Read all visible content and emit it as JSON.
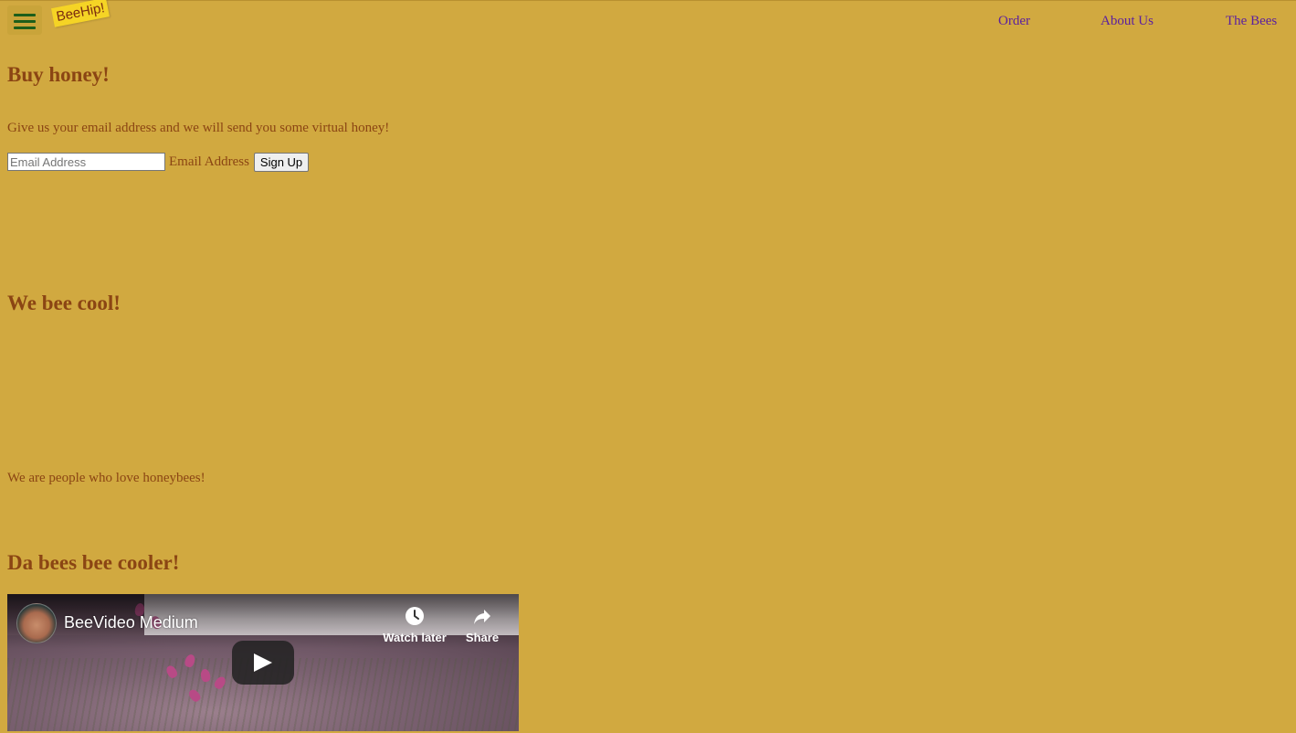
{
  "header": {
    "menu_icon": "hamburger-menu-icon",
    "logo_text": "BeeHip!",
    "nav": [
      {
        "label": "Order"
      },
      {
        "label": "About Us"
      },
      {
        "label": "The Bees"
      }
    ]
  },
  "sections": {
    "buy": {
      "heading": "Buy honey!",
      "intro": "Give us your email address and we will send you some virtual honey!",
      "email_placeholder": "Email Address",
      "email_label": "Email Address",
      "signup_button": "Sign Up"
    },
    "cool": {
      "heading": "We bee cool!",
      "text": "We are people who love honeybees!"
    },
    "cooler": {
      "heading": "Da bees bee cooler!"
    }
  },
  "video": {
    "title": "BeeVideo Medium",
    "watch_later": "Watch later",
    "share": "Share",
    "watch_icon": "clock-icon",
    "share_icon": "share-arrow-icon",
    "play_icon": "play-icon"
  },
  "colors": {
    "background": "#d1a940",
    "text": "#8b4513",
    "nav_link": "#5a1ea0",
    "logo_bg": "#f5d425",
    "menu_icon": "#1d5e1a"
  }
}
